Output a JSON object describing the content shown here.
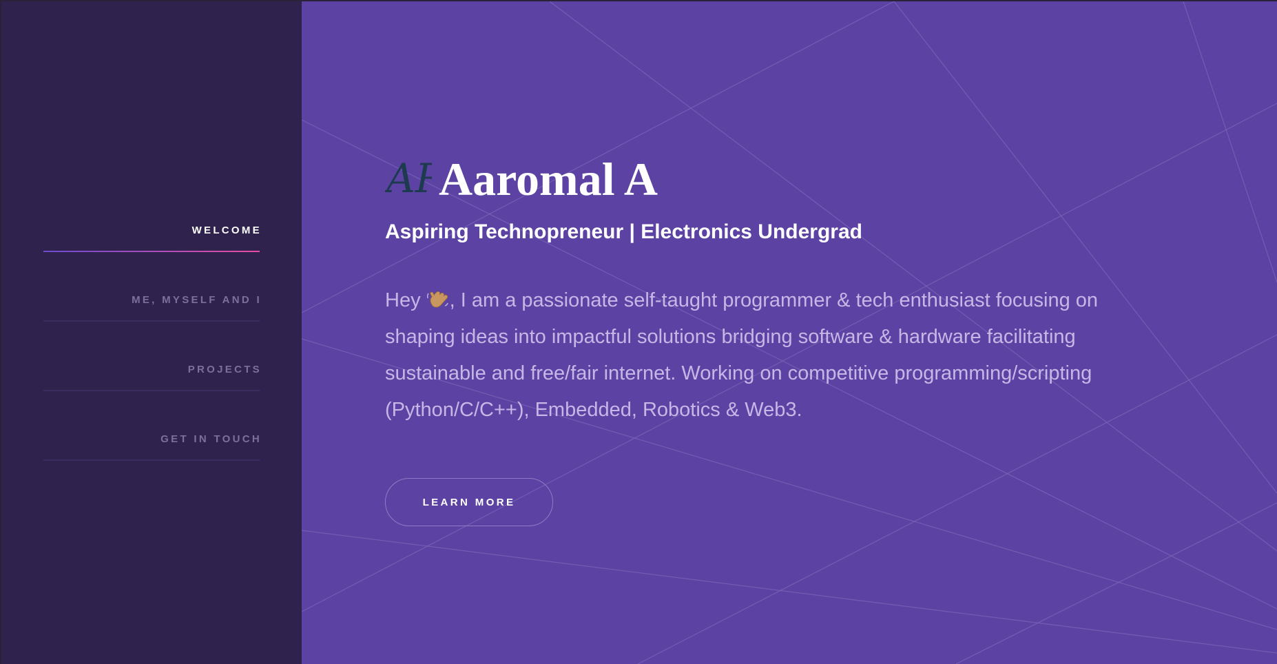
{
  "sidebar": {
    "items": [
      {
        "label": "WELCOME",
        "active": true
      },
      {
        "label": "ME, MYSELF AND I",
        "active": false
      },
      {
        "label": "PROJECTS",
        "active": false
      },
      {
        "label": "GET IN TOUCH",
        "active": false
      }
    ]
  },
  "hero": {
    "logo": "AR",
    "logo_icon": "ar-monogram-icon",
    "name": "Aaromal A",
    "tagline": "Aspiring Technopreneur | Electronics Undergrad",
    "intro_before": "Hey ",
    "intro_icon": "waving-hand-icon",
    "intro_after": ", I am a passionate self-taught programmer & tech enthusiast focusing on shaping ideas into impactful solutions bridging software & hardware facilitating sustainable and free/fair internet. Working on competitive programming/scripting (Python/C/C++), Embedded, Robotics & Web3.",
    "cta_label": "LEARN MORE"
  },
  "colors": {
    "sidebar_bg": "#2f234d",
    "main_bg": "#5c43a3",
    "accent_gradient_start": "#6d4bd1",
    "accent_gradient_end": "#ea4ca2",
    "intro_text": "#c6b7e6"
  }
}
